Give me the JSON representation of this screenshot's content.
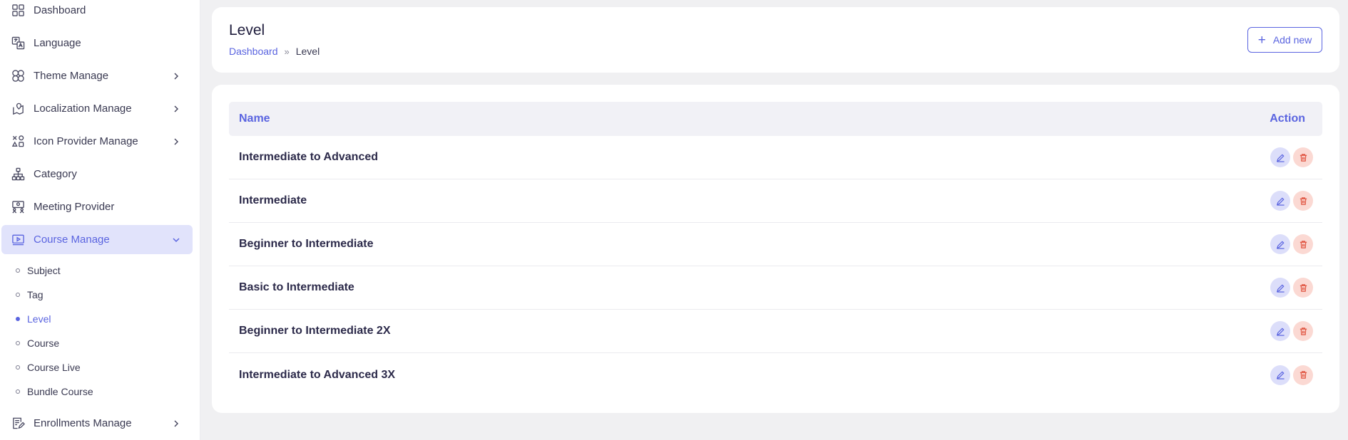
{
  "sidebar": {
    "items": [
      {
        "label": "Dashboard",
        "icon": "grid-icon",
        "has_submenu": false
      },
      {
        "label": "Language",
        "icon": "translate-icon",
        "has_submenu": false
      },
      {
        "label": "Theme Manage",
        "icon": "theme-icon",
        "has_submenu": true
      },
      {
        "label": "Localization Manage",
        "icon": "map-pin-icon",
        "has_submenu": true
      },
      {
        "label": "Icon Provider Manage",
        "icon": "shapes-icon",
        "has_submenu": true
      },
      {
        "label": "Category",
        "icon": "hierarchy-icon",
        "has_submenu": false
      },
      {
        "label": "Meeting Provider",
        "icon": "meeting-icon",
        "has_submenu": false
      },
      {
        "label": "Course Manage",
        "icon": "video-icon",
        "has_submenu": true,
        "active": true
      },
      {
        "label": "Enrollments Manage",
        "icon": "document-edit-icon",
        "has_submenu": true
      }
    ],
    "course_submenu": [
      {
        "label": "Subject",
        "active": false
      },
      {
        "label": "Tag",
        "active": false
      },
      {
        "label": "Level",
        "active": true
      },
      {
        "label": "Course",
        "active": false
      },
      {
        "label": "Course Live",
        "active": false
      },
      {
        "label": "Bundle Course",
        "active": false
      }
    ]
  },
  "header": {
    "title": "Level",
    "breadcrumb": {
      "home": "Dashboard",
      "separator": "»",
      "current": "Level"
    },
    "add_button_label": "Add new"
  },
  "table": {
    "columns": {
      "name": "Name",
      "action": "Action"
    },
    "rows": [
      {
        "name": "Intermediate to Advanced"
      },
      {
        "name": "Intermediate"
      },
      {
        "name": "Beginner to Intermediate"
      },
      {
        "name": "Basic to Intermediate"
      },
      {
        "name": "Beginner to Intermediate 2X"
      },
      {
        "name": "Intermediate to Advanced 3X"
      }
    ]
  },
  "colors": {
    "accent": "#5a64e0",
    "active_nav_bg": "#e1e3fb",
    "edit_button_bg": "#dcdefa",
    "delete_button_bg": "#fbd9d3",
    "delete_icon": "#e0533f",
    "page_bg": "#f0f0f2"
  }
}
